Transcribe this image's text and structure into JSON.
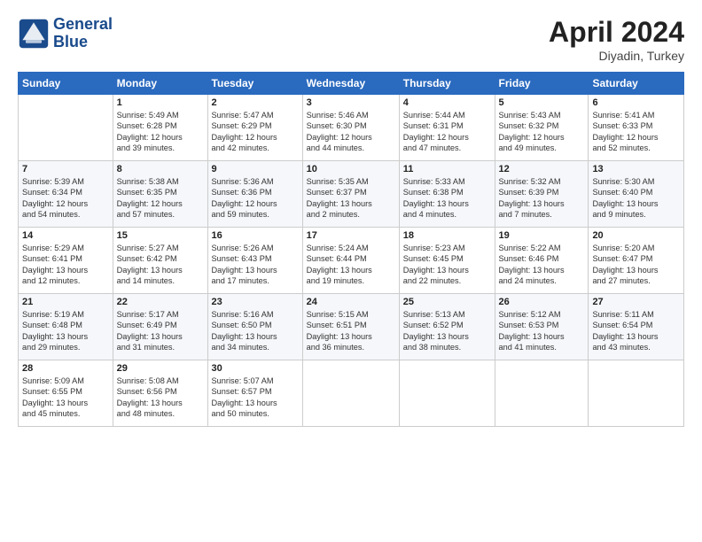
{
  "header": {
    "logo_line1": "General",
    "logo_line2": "Blue",
    "month_year": "April 2024",
    "location": "Diyadin, Turkey"
  },
  "days_of_week": [
    "Sunday",
    "Monday",
    "Tuesday",
    "Wednesday",
    "Thursday",
    "Friday",
    "Saturday"
  ],
  "weeks": [
    [
      {
        "day": "",
        "info": ""
      },
      {
        "day": "1",
        "info": "Sunrise: 5:49 AM\nSunset: 6:28 PM\nDaylight: 12 hours\nand 39 minutes."
      },
      {
        "day": "2",
        "info": "Sunrise: 5:47 AM\nSunset: 6:29 PM\nDaylight: 12 hours\nand 42 minutes."
      },
      {
        "day": "3",
        "info": "Sunrise: 5:46 AM\nSunset: 6:30 PM\nDaylight: 12 hours\nand 44 minutes."
      },
      {
        "day": "4",
        "info": "Sunrise: 5:44 AM\nSunset: 6:31 PM\nDaylight: 12 hours\nand 47 minutes."
      },
      {
        "day": "5",
        "info": "Sunrise: 5:43 AM\nSunset: 6:32 PM\nDaylight: 12 hours\nand 49 minutes."
      },
      {
        "day": "6",
        "info": "Sunrise: 5:41 AM\nSunset: 6:33 PM\nDaylight: 12 hours\nand 52 minutes."
      }
    ],
    [
      {
        "day": "7",
        "info": "Sunrise: 5:39 AM\nSunset: 6:34 PM\nDaylight: 12 hours\nand 54 minutes."
      },
      {
        "day": "8",
        "info": "Sunrise: 5:38 AM\nSunset: 6:35 PM\nDaylight: 12 hours\nand 57 minutes."
      },
      {
        "day": "9",
        "info": "Sunrise: 5:36 AM\nSunset: 6:36 PM\nDaylight: 12 hours\nand 59 minutes."
      },
      {
        "day": "10",
        "info": "Sunrise: 5:35 AM\nSunset: 6:37 PM\nDaylight: 13 hours\nand 2 minutes."
      },
      {
        "day": "11",
        "info": "Sunrise: 5:33 AM\nSunset: 6:38 PM\nDaylight: 13 hours\nand 4 minutes."
      },
      {
        "day": "12",
        "info": "Sunrise: 5:32 AM\nSunset: 6:39 PM\nDaylight: 13 hours\nand 7 minutes."
      },
      {
        "day": "13",
        "info": "Sunrise: 5:30 AM\nSunset: 6:40 PM\nDaylight: 13 hours\nand 9 minutes."
      }
    ],
    [
      {
        "day": "14",
        "info": "Sunrise: 5:29 AM\nSunset: 6:41 PM\nDaylight: 13 hours\nand 12 minutes."
      },
      {
        "day": "15",
        "info": "Sunrise: 5:27 AM\nSunset: 6:42 PM\nDaylight: 13 hours\nand 14 minutes."
      },
      {
        "day": "16",
        "info": "Sunrise: 5:26 AM\nSunset: 6:43 PM\nDaylight: 13 hours\nand 17 minutes."
      },
      {
        "day": "17",
        "info": "Sunrise: 5:24 AM\nSunset: 6:44 PM\nDaylight: 13 hours\nand 19 minutes."
      },
      {
        "day": "18",
        "info": "Sunrise: 5:23 AM\nSunset: 6:45 PM\nDaylight: 13 hours\nand 22 minutes."
      },
      {
        "day": "19",
        "info": "Sunrise: 5:22 AM\nSunset: 6:46 PM\nDaylight: 13 hours\nand 24 minutes."
      },
      {
        "day": "20",
        "info": "Sunrise: 5:20 AM\nSunset: 6:47 PM\nDaylight: 13 hours\nand 27 minutes."
      }
    ],
    [
      {
        "day": "21",
        "info": "Sunrise: 5:19 AM\nSunset: 6:48 PM\nDaylight: 13 hours\nand 29 minutes."
      },
      {
        "day": "22",
        "info": "Sunrise: 5:17 AM\nSunset: 6:49 PM\nDaylight: 13 hours\nand 31 minutes."
      },
      {
        "day": "23",
        "info": "Sunrise: 5:16 AM\nSunset: 6:50 PM\nDaylight: 13 hours\nand 34 minutes."
      },
      {
        "day": "24",
        "info": "Sunrise: 5:15 AM\nSunset: 6:51 PM\nDaylight: 13 hours\nand 36 minutes."
      },
      {
        "day": "25",
        "info": "Sunrise: 5:13 AM\nSunset: 6:52 PM\nDaylight: 13 hours\nand 38 minutes."
      },
      {
        "day": "26",
        "info": "Sunrise: 5:12 AM\nSunset: 6:53 PM\nDaylight: 13 hours\nand 41 minutes."
      },
      {
        "day": "27",
        "info": "Sunrise: 5:11 AM\nSunset: 6:54 PM\nDaylight: 13 hours\nand 43 minutes."
      }
    ],
    [
      {
        "day": "28",
        "info": "Sunrise: 5:09 AM\nSunset: 6:55 PM\nDaylight: 13 hours\nand 45 minutes."
      },
      {
        "day": "29",
        "info": "Sunrise: 5:08 AM\nSunset: 6:56 PM\nDaylight: 13 hours\nand 48 minutes."
      },
      {
        "day": "30",
        "info": "Sunrise: 5:07 AM\nSunset: 6:57 PM\nDaylight: 13 hours\nand 50 minutes."
      },
      {
        "day": "",
        "info": ""
      },
      {
        "day": "",
        "info": ""
      },
      {
        "day": "",
        "info": ""
      },
      {
        "day": "",
        "info": ""
      }
    ]
  ]
}
